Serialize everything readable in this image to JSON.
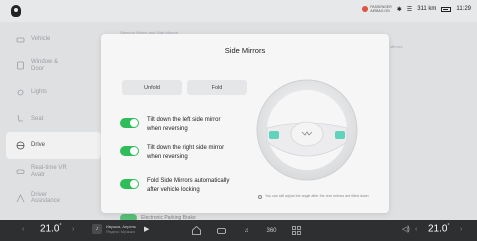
{
  "status": {
    "airbag_line1": "PASSENGER",
    "airbag_line2": "AIRBAG ON",
    "range": "311 km",
    "time": "11:29"
  },
  "sidebar": {
    "items": [
      {
        "label": "Vehicle",
        "icon": "car-icon",
        "active": false
      },
      {
        "label": "Window &\nDoor",
        "icon": "door-icon",
        "active": false
      },
      {
        "label": "Lights",
        "icon": "light-icon",
        "active": false
      },
      {
        "label": "Seat",
        "icon": "seat-icon",
        "active": false
      },
      {
        "label": "Drive",
        "icon": "steering-icon",
        "active": true
      },
      {
        "label": "Real-time VR\nAvatr",
        "icon": "vr-icon",
        "active": false
      },
      {
        "label": "Driver\nAssistance",
        "icon": "assist-icon",
        "active": false
      }
    ]
  },
  "background": {
    "section": "Steering Wheel and Side Mirrors",
    "right_label": "Mirrors",
    "epb": "Electronic Parking Brake"
  },
  "modal": {
    "title": "Side Mirrors",
    "unfold_label": "Unfold",
    "fold_label": "Fold",
    "options": [
      {
        "label": "Tilt down the left side mirror\nwhen reversing",
        "on": true
      },
      {
        "label": "Tilt down the right side mirror\nwhen reversing",
        "on": true
      },
      {
        "label": "Fold Side Mirrors automatically\nafter vehicle locking",
        "on": true
      }
    ],
    "note": "You can still adjust the angle after the rear mirrors are tilted down."
  },
  "bottom": {
    "left_temp": "21.0",
    "right_temp": "21.0",
    "track": "Ивушка, Апрель",
    "track_sub": "Яндекс Музыка",
    "dock_icons": [
      "home-icon",
      "car-dock-icon",
      "music-icon",
      "360-icon",
      "apps-icon"
    ],
    "dock_360": "360"
  },
  "colors": {
    "toggle_on": "#2ebd59",
    "bottom_bar": "#2e2f31"
  }
}
